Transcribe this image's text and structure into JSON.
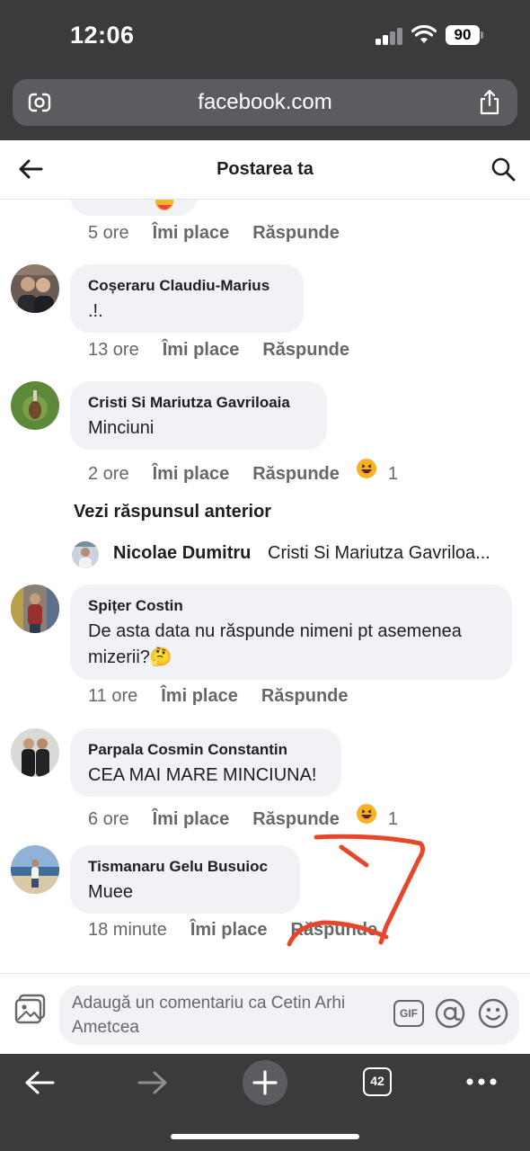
{
  "status_bar": {
    "time": "12:06",
    "battery": "90"
  },
  "browser": {
    "url": "facebook.com",
    "tab_count": "42"
  },
  "header": {
    "title": "Postarea ta"
  },
  "comments": [
    {
      "name": "",
      "text": "",
      "time": "5 ore",
      "like_label": "Îmi place",
      "reply_label": "Răspunde",
      "reaction_count": ""
    },
    {
      "name": "Coșeraru Claudiu-Marius",
      "text": ".!.",
      "time": "13 ore",
      "like_label": "Îmi place",
      "reply_label": "Răspunde",
      "reaction_count": ""
    },
    {
      "name": "Cristi Si Mariutza Gavriloaia",
      "text": "Minciuni",
      "time": "2 ore",
      "like_label": "Îmi place",
      "reply_label": "Răspunde",
      "reaction_count": "1"
    },
    {
      "name": "Spițer Costin",
      "text": "De asta data nu răspunde nimeni pt asemenea mizerii?🤔",
      "time": "11 ore",
      "like_label": "Îmi place",
      "reply_label": "Răspunde",
      "reaction_count": ""
    },
    {
      "name": "Parpala Cosmin Constantin",
      "text": "CEA MAI MARE MINCIUNA!",
      "time": "6 ore",
      "like_label": "Îmi place",
      "reply_label": "Răspunde",
      "reaction_count": "1"
    },
    {
      "name": "Tismanaru Gelu Busuioc",
      "text": "Muee",
      "time": "18 minute",
      "like_label": "Îmi place",
      "reply_label": "Răspunde",
      "reaction_count": ""
    }
  ],
  "replies_section": {
    "see_previous": "Vezi răspunsul anterior",
    "reply_name": "Nicolae Dumitru",
    "reply_preview": "Cristi Si Mariutza Gavriloa..."
  },
  "composer": {
    "placeholder": "Adaugă un comentariu ca Cetin Arhi Ametcea",
    "gif_label": "GIF"
  },
  "colors": {
    "browser_chrome": "#3a3b3d",
    "bubble": "#f0f2f5",
    "secondary_text": "#65676b",
    "annotation_scribble": "#e8462a"
  }
}
